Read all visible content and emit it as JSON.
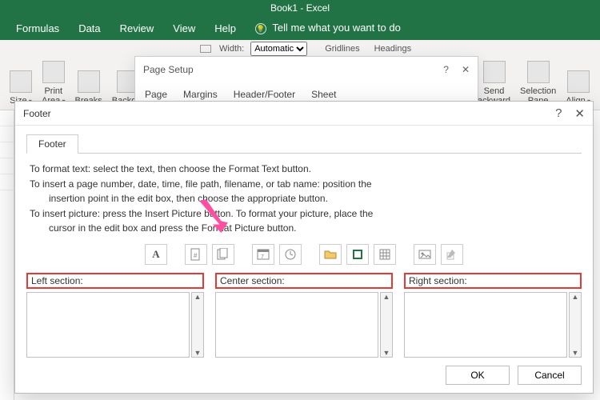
{
  "app": {
    "title": "Book1 - Excel"
  },
  "tabs": {
    "formulas": "Formulas",
    "data": "Data",
    "review": "Review",
    "view": "View",
    "help": "Help",
    "tell": "Tell me what you want to do"
  },
  "ribbon": {
    "size": "Size",
    "print_area": "Print\nArea",
    "breaks": "Breaks",
    "background": "Backgro",
    "width_label": "Width:",
    "width_value": "Automatic",
    "gridlines": "Gridlines",
    "headings": "Headings",
    "send_backward": "Send\nackward",
    "selection_pane": "Selection\nPane",
    "align": "Align"
  },
  "pagesetup": {
    "title": "Page Setup",
    "help": "?",
    "tabs": {
      "page": "Page",
      "margins": "Margins",
      "headerfooter": "Header/Footer",
      "sheet": "Sheet"
    }
  },
  "footerdlg": {
    "title": "Footer",
    "help": "?",
    "tab": "Footer",
    "instr1": "To format text:  select the text, then choose the Format Text button.",
    "instr2a": "To insert a page number, date, time, file path, filename, or tab name:  position the",
    "instr2b": "insertion point in the edit box, then choose the appropriate button.",
    "instr3a": "To insert picture: press the Insert Picture button.  To format your picture, place the",
    "instr3b": "cursor in the edit box and press the Format Picture button.",
    "buttons": {
      "format_text": "A",
      "page_number": "page-number",
      "pages": "pages",
      "date": "date",
      "time": "time",
      "file_path": "file-path",
      "file_name": "file-name",
      "sheet_name": "sheet-name",
      "insert_pic": "insert-picture",
      "format_pic": "format-picture"
    },
    "sections": {
      "left": "Left section:",
      "center": "Center section:",
      "right": "Right section:"
    },
    "ok": "OK",
    "cancel": "Cancel"
  }
}
